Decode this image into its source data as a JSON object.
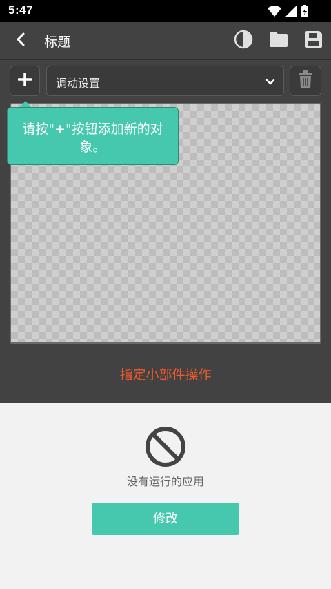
{
  "status_bar": {
    "time": "5:47",
    "icons": [
      "wifi-icon",
      "signal-icon",
      "battery-charging-icon"
    ]
  },
  "app_bar": {
    "title": "标题",
    "actions": [
      "contrast-icon",
      "folder-icon",
      "save-icon"
    ]
  },
  "toolbar": {
    "add_label": "+",
    "dropdown_value": "调动设置",
    "delete_icon": "trash-icon"
  },
  "tooltip": {
    "text": "请按\"+\"按钮添加新的对象。"
  },
  "assign_action": {
    "label": "指定小部件操作"
  },
  "bottom_panel": {
    "icon": "no-entry-icon",
    "message": "没有运行的应用",
    "button_label": "修改"
  },
  "colors": {
    "accent": "#45c8ae",
    "link": "#f0592b",
    "background": "#424242"
  }
}
